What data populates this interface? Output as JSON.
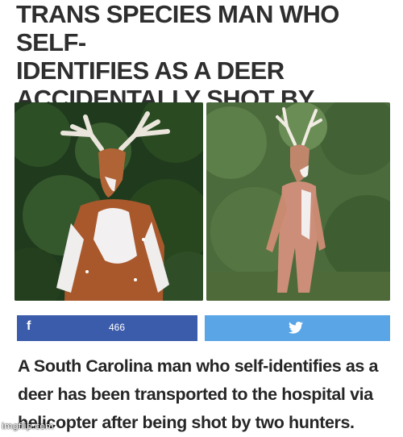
{
  "headline": {
    "line1": "TRANS SPECIES MAN WHO SELF-",
    "line2": "IDENTIFIES AS A DEER",
    "line3": "ACCIDENTALLY SHOT BY HUNTERS"
  },
  "photos": {
    "left_subject": "deer-costume-front",
    "right_subject": "deer-costume-walking"
  },
  "share": {
    "facebook_icon": "f",
    "facebook_count": "466",
    "twitter_icon": "bird-icon",
    "facebook_color": "#3b5bab",
    "twitter_color": "#5aa5e5"
  },
  "article": {
    "line1": "A South Carolina man who self-identifies as a",
    "line2": "deer has been transported to the hospital via",
    "line3": "helicopter after being shot by two hunters."
  },
  "watermark": "imgflip.com"
}
